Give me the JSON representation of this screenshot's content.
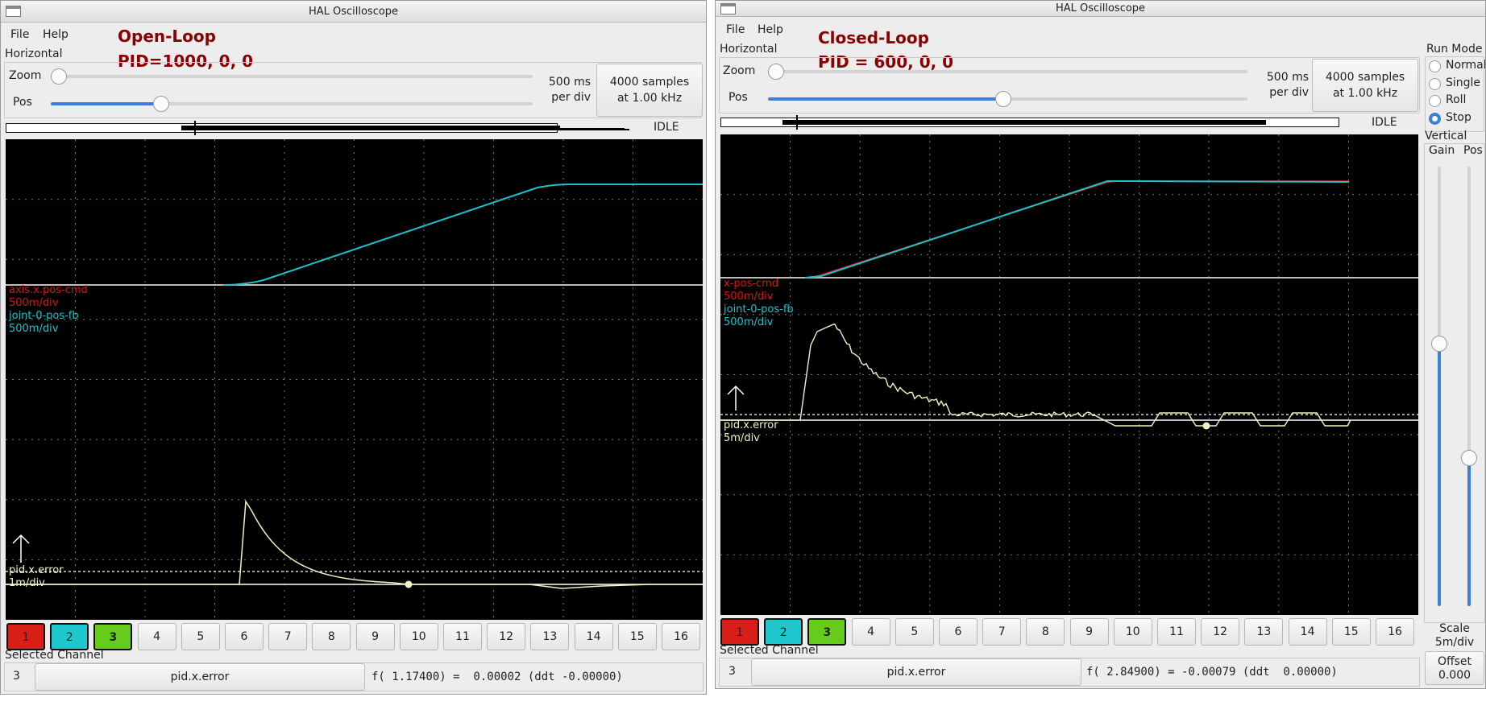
{
  "colors": {
    "ch1": "#dd1111",
    "ch2": "#19c3cc",
    "ch3": "#f0f4c0",
    "ch1_button": "#d91e18",
    "ch2_button": "#1fc8cf",
    "ch3_button": "#66cc1c",
    "annotation": "#8b0000",
    "accent": "#3c7fd6"
  },
  "left": {
    "title": "HAL Oscilloscope",
    "menu": [
      "File",
      "Help"
    ],
    "annotation": [
      "Open-Loop",
      "PID=1000, 0, 0"
    ],
    "horizontal_label": "Horizontal",
    "zoom_label": "Zoom",
    "pos_label": "Pos",
    "zoom_level": 0.0,
    "pos_level": 0.22,
    "time_per_div": [
      "500 ms",
      "per div"
    ],
    "samples_button": [
      "4000 samples",
      "at 1.00 kHz"
    ],
    "state": "IDLE",
    "channel_labels": [
      {
        "text": "axis.x.pos-cmd",
        "color": "ch1"
      },
      {
        "text": "500m/div",
        "color": "ch1"
      },
      {
        "text": "joint-0-pos-fb",
        "color": "ch2"
      },
      {
        "text": "500m/div",
        "color": "ch2"
      }
    ],
    "error_labels": [
      "pid.x.error",
      "1m/div"
    ],
    "channel_buttons": [
      "1",
      "2",
      "3",
      "4",
      "5",
      "6",
      "7",
      "8",
      "9",
      "10",
      "11",
      "12",
      "13",
      "14",
      "15",
      "16"
    ],
    "selected_channel_label": "Selected Channel",
    "selected_channel_number": "3",
    "selected_channel_name": "pid.x.error",
    "readout": "f( 1.17400) =  0.00002 (ddt -0.00000)"
  },
  "right": {
    "title": "HAL Oscilloscope",
    "menu": [
      "File",
      "Help"
    ],
    "annotation": [
      "Closed-Loop",
      "PID = 600, 0, 0"
    ],
    "horizontal_label": "Horizontal",
    "zoom_label": "Zoom",
    "pos_label": "Pos",
    "zoom_level": 0.0,
    "pos_level": 0.49,
    "time_per_div": [
      "500 ms",
      "per div"
    ],
    "samples_button": [
      "4000 samples",
      "at 1.00 kHz"
    ],
    "state": "IDLE",
    "channel_labels": [
      {
        "text": "x-pos-cmd",
        "color": "ch1"
      },
      {
        "text": "500m/div",
        "color": "ch1"
      },
      {
        "text": "joint-0-pos-fb",
        "color": "ch2"
      },
      {
        "text": "500m/div",
        "color": "ch2"
      }
    ],
    "error_labels": [
      "pid.x.error",
      "5m/div"
    ],
    "channel_buttons": [
      "1",
      "2",
      "3",
      "4",
      "5",
      "6",
      "7",
      "8",
      "9",
      "10",
      "11",
      "12",
      "13",
      "14",
      "15",
      "16"
    ],
    "selected_channel_label": "Selected Channel",
    "selected_channel_number": "3",
    "selected_channel_name": "pid.x.error",
    "readout": "f( 2.84900) = -0.00079 (ddt  0.00000)",
    "run_mode_label": "Run Mode",
    "run_modes": [
      "Normal",
      "Single",
      "Roll",
      "Stop"
    ],
    "run_mode_selected": "Stop",
    "vertical_label": "Vertical",
    "gain_label": "Gain",
    "vpos_label": "Pos",
    "gain_level": 0.6,
    "vpos_level": 0.33,
    "scale_label": [
      "Scale",
      "5m/div"
    ],
    "offset_button": [
      "Offset",
      "0.000"
    ]
  }
}
